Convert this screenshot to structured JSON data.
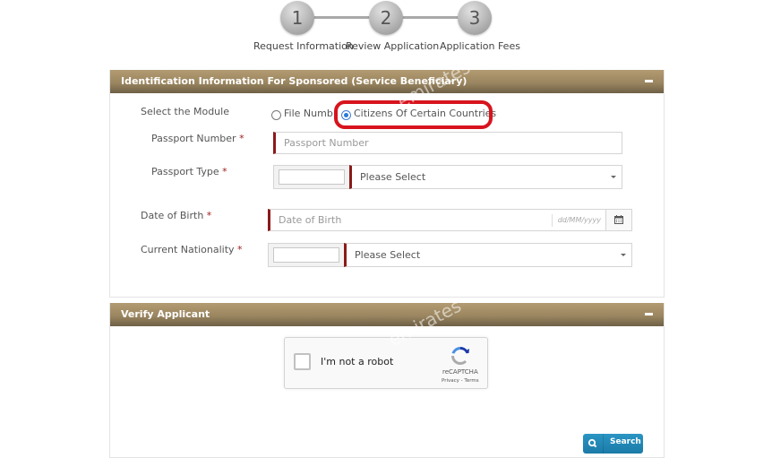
{
  "stepper": {
    "steps": [
      {
        "number": "1",
        "label": "Request Information"
      },
      {
        "number": "2",
        "label": "Review Application"
      },
      {
        "number": "3",
        "label": "Application Fees"
      }
    ]
  },
  "identification_panel": {
    "title": "Identification Information For Sponsored (Service Beneficiary)",
    "collapse_icon": "minus-icon",
    "module": {
      "label": "Select the Module",
      "options": [
        {
          "label": "File Number",
          "visible_text": "File Numbe",
          "selected": false
        },
        {
          "label": "Citizens Of Certain Countries",
          "selected": true
        }
      ],
      "highlight_color": "#d7141e"
    },
    "passport_number": {
      "label": "Passport Number",
      "required_mark": "*",
      "placeholder": "Passport Number",
      "value": ""
    },
    "passport_type": {
      "label": "Passport Type",
      "required_mark": "*",
      "code_value": "",
      "selected": "Please Select"
    },
    "date_of_birth": {
      "label": "Date of Birth",
      "required_mark": "*",
      "placeholder": "Date of Birth",
      "format_hint": "dd/MM/yyyy",
      "calendar_icon": "calendar-icon"
    },
    "current_nationality": {
      "label": "Current Nationality",
      "required_mark": "*",
      "code_value": "",
      "selected": "Please Select"
    }
  },
  "verify_panel": {
    "title": "Verify Applicant",
    "collapse_icon": "minus-icon",
    "recaptcha": {
      "label": "I'm not a robot",
      "brand": "reCAPTCHA",
      "links": "Privacy - Terms",
      "checked": false
    },
    "search_button": {
      "label": "Search",
      "icon": "search-icon"
    }
  },
  "watermark_text": "emirates",
  "colors": {
    "header_gradient_top": "#b39b72",
    "header_gradient_bottom": "#6e5f46",
    "required_accent": "#8b1a1a",
    "button_blue": "#2a95c4",
    "radio_selected": "#2a7ad9"
  }
}
